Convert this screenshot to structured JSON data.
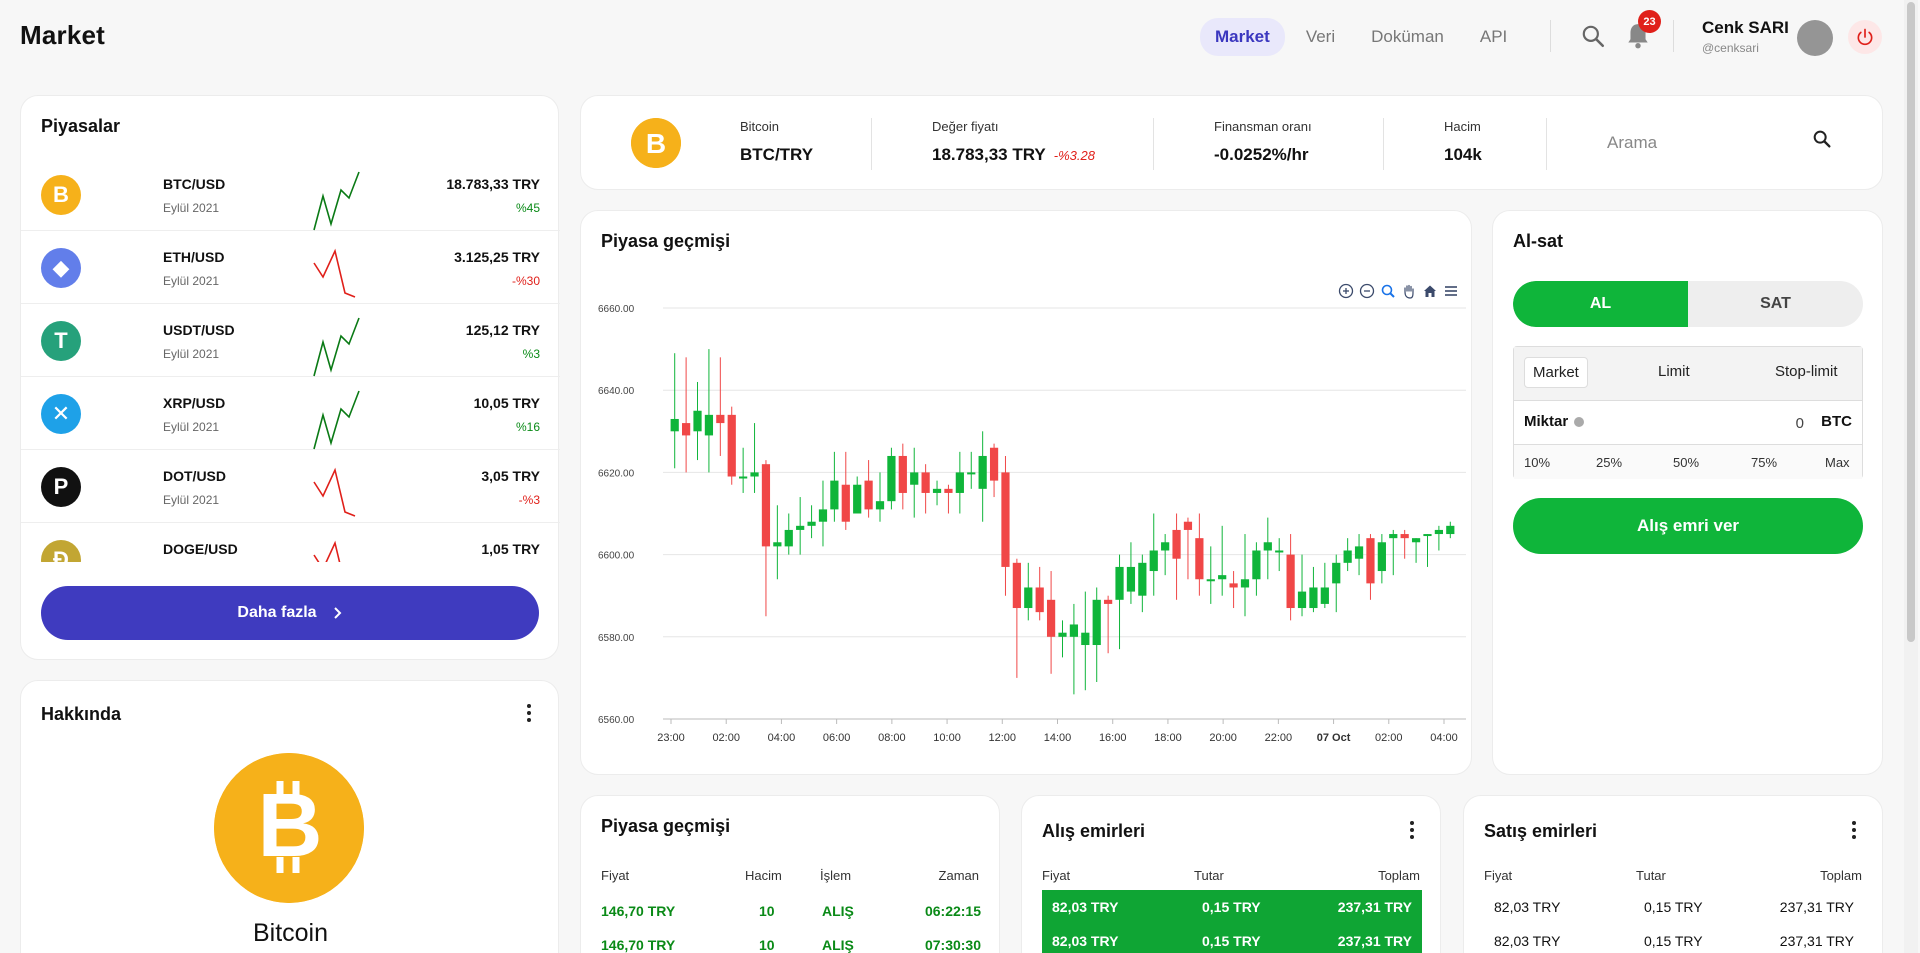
{
  "header": {
    "title": "Market",
    "nav": [
      "Market",
      "Veri",
      "Doküman",
      "API"
    ],
    "active_nav": "Market",
    "notifications": "23",
    "user_name": "Cenk SARI",
    "user_handle": "@cenksari"
  },
  "markets": {
    "title": "Piyasalar",
    "more_label": "Daha fazla",
    "items": [
      {
        "pair": "BTC/USD",
        "date": "Eylül 2021",
        "price": "18.783,33 TRY",
        "change": "%45",
        "trend": "up",
        "icon": "bitcoin-icon",
        "color": "#f6b11a"
      },
      {
        "pair": "ETH/USD",
        "date": "Eylül 2021",
        "price": "3.125,25 TRY",
        "change": "-%30",
        "trend": "down",
        "icon": "ethereum-icon",
        "color": "#627eea"
      },
      {
        "pair": "USDT/USD",
        "date": "Eylül 2021",
        "price": "125,12 TRY",
        "change": "%3",
        "trend": "up",
        "icon": "tether-icon",
        "color": "#26a17b"
      },
      {
        "pair": "XRP/USD",
        "date": "Eylül 2021",
        "price": "10,05 TRY",
        "change": "%16",
        "trend": "up",
        "icon": "ripple-icon",
        "color": "#1ea1e8"
      },
      {
        "pair": "DOT/USD",
        "date": "Eylül 2021",
        "price": "3,05 TRY",
        "change": "-%3",
        "trend": "down",
        "icon": "polkadot-icon",
        "color": "#111111"
      },
      {
        "pair": "DOGE/USD",
        "date": "",
        "price": "1,05 TRY",
        "change": "",
        "trend": "down",
        "icon": "dogecoin-icon",
        "color": "#c2a633"
      }
    ]
  },
  "about": {
    "title": "Hakkında",
    "coin_name": "Bitcoin"
  },
  "ticker": {
    "coin_name": "Bitcoin",
    "pair": "BTC/TRY",
    "price_label": "Değer fiyatı",
    "price": "18.783,33 TRY",
    "price_change": "-%3.28",
    "funding_label": "Finansman oranı",
    "funding": "-0.0252%/hr",
    "volume_label": "Hacim",
    "volume": "104k",
    "search_placeholder": "Arama"
  },
  "chart_card": {
    "title": "Piyasa geçmişi"
  },
  "chart_data": {
    "type": "candlestick",
    "title": "Piyasa geçmişi",
    "ylim": [
      6560,
      6660
    ],
    "y_ticks": [
      "6660.00",
      "6640.00",
      "6620.00",
      "6600.00",
      "6580.00",
      "6560.00"
    ],
    "x_ticks": [
      "23:00",
      "02:00",
      "04:00",
      "06:00",
      "08:00",
      "10:00",
      "12:00",
      "14:00",
      "16:00",
      "18:00",
      "20:00",
      "22:00",
      "07 Oct",
      "02:00",
      "04:00"
    ],
    "colors": {
      "up": "#0fb53a",
      "down": "#f04747"
    },
    "candles": [
      [
        6630,
        6633,
        6621,
        6649
      ],
      [
        6632,
        6629,
        6620,
        6648
      ],
      [
        6630,
        6635,
        6623,
        6642
      ],
      [
        6629,
        6634,
        6620,
        6650
      ],
      [
        6634,
        6632,
        6624,
        6648
      ],
      [
        6634,
        6619,
        6617,
        6636
      ],
      [
        6619,
        6619,
        6615,
        6626
      ],
      [
        6619,
        6620,
        6615,
        6632
      ],
      [
        6622,
        6602,
        6585,
        6623
      ],
      [
        6602,
        6603,
        6594,
        6612
      ],
      [
        6602,
        6606,
        6600,
        6610
      ],
      [
        6606,
        6607,
        6600,
        6614
      ],
      [
        6607,
        6608,
        6604,
        6612
      ],
      [
        6608,
        6611,
        6602,
        6618
      ],
      [
        6611,
        6618,
        6608,
        6625
      ],
      [
        6617,
        6608,
        6606,
        6625
      ],
      [
        6610,
        6617,
        6610,
        6619
      ],
      [
        6618,
        6611,
        6609,
        6623
      ],
      [
        6611,
        6613,
        6608,
        6620
      ],
      [
        6613,
        6624,
        6611,
        6626
      ],
      [
        6624,
        6615,
        6611,
        6627
      ],
      [
        6617,
        6620,
        6609,
        6626
      ],
      [
        6620,
        6615,
        6610,
        6622
      ],
      [
        6615,
        6616,
        6612,
        6618
      ],
      [
        6616,
        6615,
        6610,
        6617
      ],
      [
        6615,
        6620,
        6610,
        6625
      ],
      [
        6620,
        6620,
        6616,
        6625
      ],
      [
        6616,
        6624,
        6608,
        6630
      ],
      [
        6626,
        6618,
        6614,
        6627
      ],
      [
        6620,
        6597,
        6590,
        6624
      ],
      [
        6598,
        6587,
        6570,
        6599
      ],
      [
        6587,
        6592,
        6584,
        6598
      ],
      [
        6592,
        6586,
        6584,
        6597
      ],
      [
        6589,
        6580,
        6571,
        6596
      ],
      [
        6580,
        6581,
        6575,
        6584
      ],
      [
        6580,
        6583,
        6566,
        6588
      ],
      [
        6578,
        6581,
        6567,
        6591
      ],
      [
        6578,
        6589,
        6569,
        6592
      ],
      [
        6589,
        6588,
        6576,
        6590
      ],
      [
        6589,
        6597,
        6577,
        6600
      ],
      [
        6591,
        6597,
        6588,
        6603
      ],
      [
        6590,
        6598,
        6586,
        6600
      ],
      [
        6596,
        6601,
        6590,
        6610
      ],
      [
        6601,
        6603,
        6595,
        6605
      ],
      [
        6606,
        6599,
        6589,
        6610
      ],
      [
        6608,
        6606,
        6594,
        6609
      ],
      [
        6604,
        6594,
        6590,
        6610
      ],
      [
        6594,
        6594,
        6588,
        6602
      ],
      [
        6594,
        6595,
        6590,
        6607
      ],
      [
        6593,
        6592,
        6587,
        6596
      ],
      [
        6592,
        6594,
        6585,
        6605
      ],
      [
        6594,
        6601,
        6590,
        6603
      ],
      [
        6601,
        6603,
        6594,
        6609
      ],
      [
        6601,
        6601,
        6596,
        6604
      ],
      [
        6600,
        6587,
        6584,
        6605
      ],
      [
        6587,
        6591,
        6585,
        6600
      ],
      [
        6587,
        6592,
        6586,
        6597
      ],
      [
        6588,
        6592,
        6587,
        6598
      ],
      [
        6593,
        6598,
        6586,
        6600
      ],
      [
        6598,
        6601,
        6596,
        6604
      ],
      [
        6599,
        6602,
        6595,
        6605
      ],
      [
        6604,
        6593,
        6589,
        6605
      ],
      [
        6596,
        6603,
        6593,
        6605
      ],
      [
        6604,
        6605,
        6595,
        6606
      ],
      [
        6605,
        6604,
        6599,
        6606
      ],
      [
        6603,
        6604,
        6598,
        6604
      ],
      [
        6605,
        6605,
        6597,
        6605
      ],
      [
        6605,
        6606,
        6601,
        6607
      ],
      [
        6605,
        6607,
        6604,
        6608
      ]
    ]
  },
  "trade": {
    "title": "Al-sat",
    "tabs": [
      "AL",
      "SAT"
    ],
    "order_types": [
      "Market",
      "Limit",
      "Stop-limit"
    ],
    "amount_label": "Miktar",
    "amount_value": "0",
    "amount_unit": "BTC",
    "percents": [
      "10%",
      "25%",
      "50%",
      "75%",
      "Max"
    ],
    "submit_label": "Alış emri ver"
  },
  "history_table": {
    "title": "Piyasa geçmişi",
    "headers": [
      "Fiyat",
      "Hacim",
      "İşlem",
      "Zaman"
    ],
    "rows": [
      [
        "146,70 TRY",
        "10",
        "ALIŞ",
        "06:22:15"
      ],
      [
        "146,70 TRY",
        "10",
        "ALIŞ",
        "07:30:30"
      ]
    ]
  },
  "bids_table": {
    "title": "Alış emirleri",
    "headers": [
      "Fiyat",
      "Tutar",
      "Toplam"
    ],
    "rows": [
      [
        "82,03 TRY",
        "0,15 TRY",
        "237,31 TRY"
      ],
      [
        "82,03 TRY",
        "0,15 TRY",
        "237,31 TRY"
      ]
    ]
  },
  "asks_table": {
    "title": "Satış emirleri",
    "headers": [
      "Fiyat",
      "Tutar",
      "Toplam"
    ],
    "rows": [
      [
        "82,03 TRY",
        "0,15 TRY",
        "237,31 TRY"
      ],
      [
        "82,03 TRY",
        "0,15 TRY",
        "237,31 TRY"
      ]
    ]
  }
}
